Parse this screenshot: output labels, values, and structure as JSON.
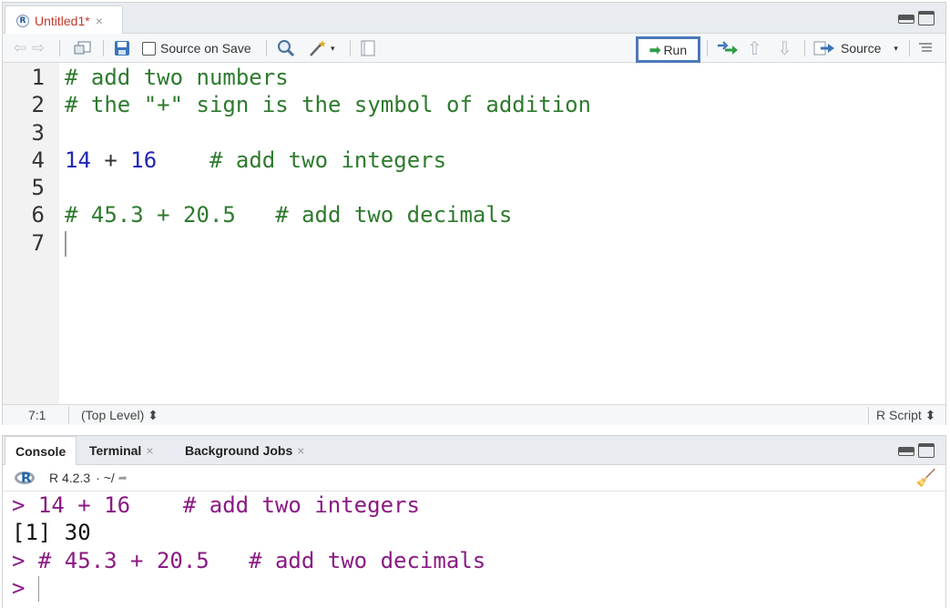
{
  "editor": {
    "tab": {
      "title": "Untitled1*",
      "close": "×"
    },
    "toolbar": {
      "source_on_save": "Source on Save",
      "run": "Run",
      "source": "Source"
    },
    "lines": [
      {
        "num": "1",
        "tokens": [
          {
            "text": "# add two numbers",
            "kind": "cmt"
          }
        ]
      },
      {
        "num": "2",
        "tokens": [
          {
            "text": "# the \"+\" sign is the symbol of addition",
            "kind": "cmt"
          }
        ]
      },
      {
        "num": "3",
        "tokens": []
      },
      {
        "num": "4",
        "tokens": [
          {
            "text": "14",
            "kind": "num"
          },
          {
            "text": " + ",
            "kind": "op"
          },
          {
            "text": "16",
            "kind": "num"
          },
          {
            "text": "    # add two integers",
            "kind": "cmt"
          }
        ]
      },
      {
        "num": "5",
        "tokens": []
      },
      {
        "num": "6",
        "tokens": [
          {
            "text": "# 45.3 + 20.5   # add two decimals",
            "kind": "cmt"
          }
        ]
      },
      {
        "num": "7",
        "tokens": []
      }
    ],
    "status": {
      "position": "7:1",
      "scope": "(Top Level) ⬍",
      "filetype": "R Script ⬍"
    }
  },
  "console": {
    "tabs": [
      {
        "label": "Console",
        "closable": false
      },
      {
        "label": "Terminal",
        "closable": true
      },
      {
        "label": "Background Jobs",
        "closable": true
      }
    ],
    "version": "R 4.2.3",
    "dir": "· ~/",
    "output": [
      {
        "text": "> 14 + 16    # add two integers",
        "kind": "cmd"
      },
      {
        "text": "[1] 30",
        "kind": "res"
      },
      {
        "text": "> # 45.3 + 20.5   # add two decimals",
        "kind": "cmd"
      },
      {
        "text": "> ",
        "kind": "cmd"
      }
    ]
  },
  "colors": {
    "comment": "#2e7a2e",
    "number": "#1f27b5",
    "console_cmd": "#8b1a84",
    "run_highlight": "#4a79b7"
  },
  "icons": [
    "r-file-icon",
    "back-icon",
    "forward-icon",
    "show-in-window-icon",
    "save-icon",
    "search-icon",
    "magic-wand-icon",
    "compile-report-icon",
    "run-arrow-icon",
    "rerun-icon",
    "up-icon",
    "down-icon",
    "source-arrow-icon",
    "outline-icon",
    "minimize-icon",
    "maximize-icon",
    "r-logo-icon",
    "broom-icon"
  ]
}
